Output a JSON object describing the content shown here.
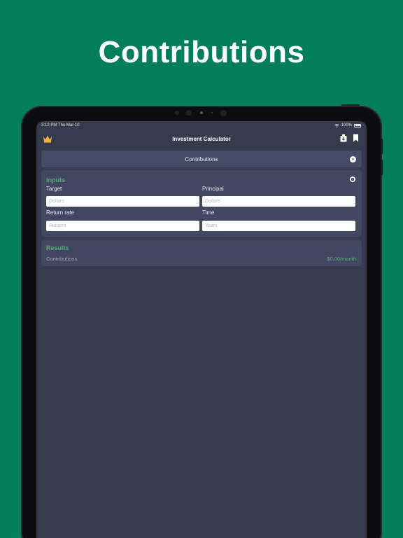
{
  "headline": "Contributions",
  "status_bar": {
    "time_date": "3:12 PM   Thu Mar 10",
    "battery": "100%"
  },
  "nav": {
    "title": "Investment Calculator",
    "left_icon": "crown-icon",
    "right_icons": [
      "calculator-export-icon",
      "bookmark-icon"
    ]
  },
  "selector": {
    "label": "Contributions",
    "icon": "chevron-down-icon"
  },
  "inputs": {
    "title": "Inputs",
    "fields": [
      {
        "label": "Target",
        "placeholder": "Dollars",
        "value": ""
      },
      {
        "label": "Principal",
        "placeholder": "Dollars",
        "value": ""
      },
      {
        "label": "Return rate",
        "placeholder": "Percent",
        "value": ""
      },
      {
        "label": "Time",
        "placeholder": "Years",
        "value": ""
      }
    ]
  },
  "results": {
    "title": "Results",
    "rows": [
      {
        "label": "Contributions",
        "value": "$0.00/month"
      }
    ]
  },
  "colors": {
    "background": "#017f5a",
    "screen": "#363a4d",
    "card": "#424660",
    "selector": "#474c66",
    "accent_green": "#4fb078",
    "crown_gold": "#f1b33a"
  }
}
